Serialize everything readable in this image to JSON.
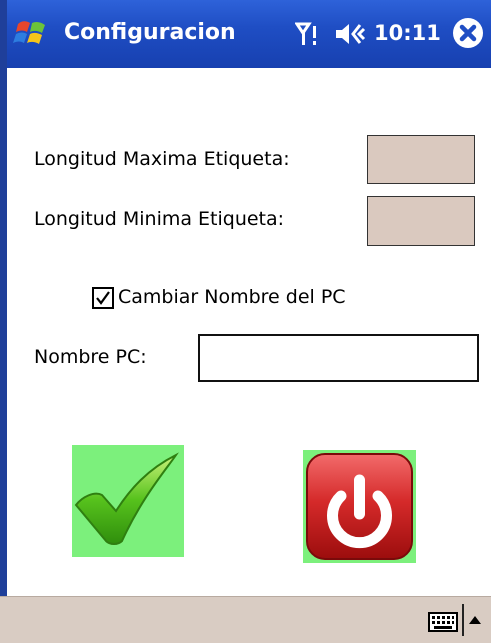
{
  "titlebar": {
    "title": "Configuracion",
    "time": "10:11",
    "icons": [
      "windows-flag-icon",
      "signal-icon",
      "volume-icon",
      "close-icon"
    ]
  },
  "form": {
    "max_label": "Longitud Maxima Etiqueta:",
    "max_value": "",
    "min_label": "Longitud Minima Etiqueta:",
    "min_value": "",
    "checkbox_label": "Cambiar Nombre del PC",
    "checkbox_checked": true,
    "pc_label": "Nombre PC:",
    "pc_value": ""
  },
  "buttons": {
    "ok_icon": "checkmark-icon",
    "power_icon": "power-icon"
  },
  "bottombar": {
    "icons": [
      "keyboard-icon",
      "up-arrow-icon"
    ]
  },
  "colors": {
    "titlebar": "#1f4ec4",
    "field_bg": "#dac9bf",
    "button_bg": "#7cf07c",
    "bottombar": "#d9ccc3"
  }
}
